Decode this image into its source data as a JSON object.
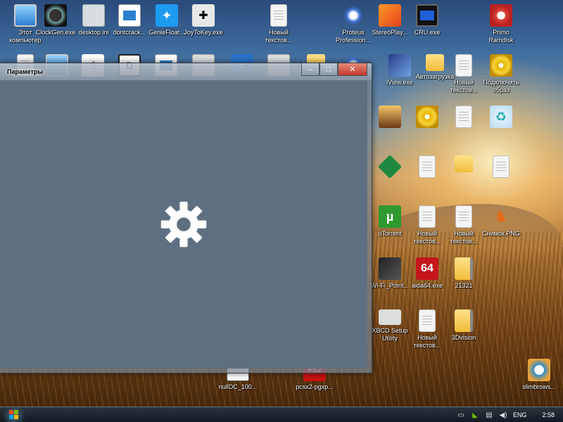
{
  "desktop": {
    "icons": [
      {
        "name": "this-pc-icon",
        "label": "Этот\nкомпьютер",
        "look": "i-monitor",
        "glyph": ""
      },
      {
        "name": "clockgen-icon",
        "label": "ClockGen.exe",
        "look": "i-clock",
        "glyph": ""
      },
      {
        "name": "desktop-ini-icon",
        "label": "desktop.ini",
        "look": "i-gear-file",
        "glyph": ""
      },
      {
        "name": "dontcrack-icon",
        "label": "dontcrack...",
        "look": "i-win",
        "glyph": ""
      },
      {
        "name": "geniefloat-icon",
        "label": "GenieFloat...",
        "look": "i-twitter",
        "glyph": "✦"
      },
      {
        "name": "joytokey-icon",
        "label": "JoyToKey.exe",
        "look": "i-joy",
        "glyph": "✚"
      },
      {
        "name": "text-file-1-icon",
        "label": "Новый\nтекстов...",
        "look": "i-file",
        "glyph": ""
      },
      {
        "name": "proteus-icon",
        "label": "Proteus\nProfession...",
        "look": "i-proteus",
        "glyph": ""
      },
      {
        "name": "stereoplayer-icon",
        "label": "StereoPlay...",
        "look": "i-stereo",
        "glyph": ""
      },
      {
        "name": "cru-icon",
        "label": "CRU.exe",
        "look": "i-cru",
        "glyph": ""
      },
      {
        "name": "primo-ramdisk-icon",
        "label": "Primo\nRamdisk",
        "look": "i-primo",
        "glyph": ""
      },
      {
        "name": "imgview-icon",
        "label": "iView.exe",
        "look": "i-imgview",
        "glyph": ""
      },
      {
        "name": "folder-autoload-icon",
        "label": "Автозагрузка",
        "look": "i-folder",
        "glyph": ""
      },
      {
        "name": "text-file-2-icon",
        "label": "Новый\nтекстов...",
        "look": "i-file",
        "glyph": ""
      },
      {
        "name": "mount-image-icon",
        "label": "Подключить\nобраз",
        "look": "i-disc",
        "glyph": ""
      },
      {
        "name": "photo-icon",
        "label": "",
        "look": "i-photo",
        "glyph": ""
      },
      {
        "name": "disc-icon",
        "label": "",
        "look": "i-disc",
        "glyph": ""
      },
      {
        "name": "text-file-3-icon",
        "label": "",
        "look": "i-file",
        "glyph": ""
      },
      {
        "name": "recycle-bin-icon",
        "label": "",
        "look": "i-recycle",
        "glyph": "♻"
      },
      {
        "name": "green-cube-icon",
        "label": "",
        "look": "i-cube",
        "glyph": ""
      },
      {
        "name": "text-file-4-icon",
        "label": "",
        "look": "i-file",
        "glyph": ""
      },
      {
        "name": "folder-2-icon",
        "label": "",
        "look": "i-folder",
        "glyph": ""
      },
      {
        "name": "text-file-5-icon",
        "label": "",
        "look": "i-file",
        "glyph": ""
      },
      {
        "name": "utorrent-icon",
        "label": "uTorrent",
        "look": "i-torrent",
        "glyph": "µ"
      },
      {
        "name": "text-file-6-icon",
        "label": "Новый\nтекстов...",
        "look": "i-file",
        "glyph": ""
      },
      {
        "name": "text-file-7-icon",
        "label": "Новый\nтекстов...",
        "look": "i-file",
        "glyph": ""
      },
      {
        "name": "screenshot-png-icon",
        "label": "Снимок.PNG",
        "look": "i-goku",
        "glyph": "♞"
      },
      {
        "name": "wifi-point-icon",
        "label": "Wi-Fi_Point...",
        "look": "i-wifi",
        "glyph": ""
      },
      {
        "name": "aida64-icon",
        "label": "aida64.exe",
        "look": "i-64",
        "glyph": "64"
      },
      {
        "name": "archive-21321-icon",
        "label": "21321",
        "look": "i-zip",
        "glyph": ""
      },
      {
        "name": "x360ce-icon",
        "label": "XBCD Setup\nUtility",
        "look": "i-pad",
        "glyph": ""
      },
      {
        "name": "text-file-8-icon",
        "label": "Новый\nтекстов...",
        "look": "i-file",
        "glyph": ""
      },
      {
        "name": "archive-3dvision-icon",
        "label": "3Dvision",
        "look": "i-zip",
        "glyph": ""
      },
      {
        "name": "nulldc-icon",
        "label": "nullDC_100...",
        "look": "i-nulldc",
        "glyph": ""
      },
      {
        "name": "pcsx2-icon",
        "label": "pcsx2-pgxp...",
        "look": "i-pcsx",
        "glyph": "PS2"
      },
      {
        "name": "slimbrowser-icon",
        "label": "slimbrows...",
        "look": "i-slim",
        "glyph": ""
      },
      {
        "name": "row2-file-icon",
        "label": "",
        "look": "i-file",
        "glyph": ""
      },
      {
        "name": "row2-monitor-icon",
        "label": "",
        "look": "i-monitor",
        "glyph": ""
      },
      {
        "name": "snail-icon",
        "label": "",
        "look": "i-snail",
        "glyph": "☃"
      },
      {
        "name": "dtools-icon",
        "label": "",
        "look": "i-dtools",
        "glyph": "D"
      },
      {
        "name": "row2-win-icon",
        "label": "",
        "look": "i-win",
        "glyph": ""
      },
      {
        "name": "row2-gray-icon",
        "label": "",
        "look": "i-gray",
        "glyph": ""
      },
      {
        "name": "row2-blue-c-icon",
        "label": "",
        "look": "i-blue-c",
        "glyph": "c"
      },
      {
        "name": "row2-gray2-icon",
        "label": "",
        "look": "i-gray",
        "glyph": ""
      },
      {
        "name": "row2-folder-icon",
        "label": "",
        "look": "i-folder",
        "glyph": ""
      },
      {
        "name": "row2-blue-icon",
        "label": "",
        "look": "i-proteus",
        "glyph": ""
      }
    ]
  },
  "settings_window": {
    "title": "Параметры",
    "minimize_glyph": "–",
    "maximize_glyph": "□",
    "close_glyph": "✕",
    "loading_icon": "gear-icon",
    "client_color": "#5e6f81"
  },
  "taskbar": {
    "language": "ENG",
    "clock": "2:58"
  }
}
